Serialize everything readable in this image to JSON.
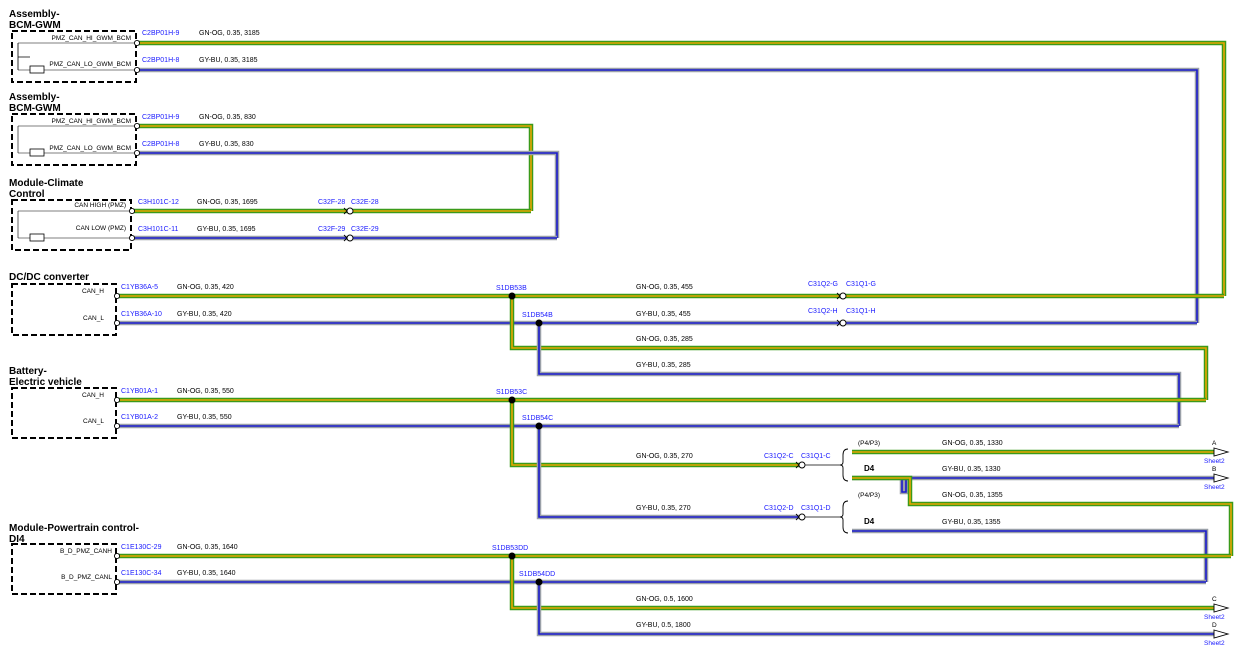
{
  "colors": {
    "can_hi_core": "#e8a600",
    "can_hi_outer": "#3a9a1a",
    "can_lo_core": "#1a1acc",
    "can_lo_outer": "#9aa0a8",
    "connector_label": "#1a1aff",
    "box_border": "#000000"
  },
  "components": [
    {
      "name_line1": "Assembly-",
      "name_line2": "BCM-GWM",
      "pin_hi": "PMZ_CAN_HI_GWM_BCM",
      "pin_lo": "PMZ_CAN_LO_GWM_BCM",
      "conn_hi": "C2BP01H-9",
      "conn_lo": "C2BP01H-8",
      "wire_hi": "GN-OG,  0.35,  3185",
      "wire_lo": "GY-BU,  0.35,  3185"
    },
    {
      "name_line1": "Assembly-",
      "name_line2": "BCM-GWM",
      "pin_hi": "PMZ_CAN_HI_GWM_BCM",
      "pin_lo": "PMZ_CAN_LO_GWM_BCM",
      "conn_hi": "C2BP01H-9",
      "conn_lo": "C2BP01H-8",
      "wire_hi": "GN-OG,  0.35,  830",
      "wire_lo": "GY-BU,  0.35,  830"
    },
    {
      "name_line1": "Module-Climate",
      "name_line2": "Control",
      "pin_hi": "CAN HIGH (PMZ)",
      "pin_lo": "CAN LOW (PMZ)",
      "conn_hi": "C3H101C-12",
      "conn_lo": "C3H101C-11",
      "wire_hi": "GN-OG,  0.35,  1695",
      "wire_lo": "GY-BU,  0.35,  1695"
    },
    {
      "name_line1": "DC/DC converter",
      "name_line2": "",
      "pin_hi": "CAN_H",
      "pin_lo": "CAN_L",
      "conn_hi": "C1YB36A-5",
      "conn_lo": "C1YB36A-10",
      "wire_hi": "GN-OG,  0.35,  420",
      "wire_lo": "GY-BU,  0.35,  420"
    },
    {
      "name_line1": "Battery-",
      "name_line2": "Electric vehicle",
      "pin_hi": "CAN_H",
      "pin_lo": "CAN_L",
      "conn_hi": "C1YB01A-1",
      "conn_lo": "C1YB01A-2",
      "wire_hi": "GN-OG,  0.35,  550",
      "wire_lo": "GY-BU,  0.35,  550"
    },
    {
      "name_line1": "Module-Powertrain control-",
      "name_line2": "DI4",
      "pin_hi": "B_D_PMZ_CANH",
      "pin_lo": "B_D_PMZ_CANL",
      "conn_hi": "C1E130C-29",
      "conn_lo": "C1E130C-34",
      "wire_hi": "GN-OG,  0.35,  1640",
      "wire_lo": "GY-BU,  0.35,  1640"
    }
  ],
  "climate_inline": {
    "hi_a": "C32F-28",
    "hi_b": "C32E-28",
    "lo_a": "C32F-29",
    "lo_b": "C32E-29"
  },
  "splices": {
    "s53b": "S1DB53B",
    "s54b": "S1DB54B",
    "s53c": "S1DB53C",
    "s54c": "S1DB54C",
    "s53dd": "S1DB53DD",
    "s54dd": "S1DB54DD"
  },
  "trunk_wires": {
    "hi_455": "GN-OG,  0.35,  455",
    "lo_455": "GY-BU,  0.35,  455",
    "hi_285": "GN-OG,  0.35,  285",
    "lo_285": "GY-BU,  0.35,  285",
    "hi_270": "GN-OG,  0.35,  270",
    "lo_270": "GY-BU,  0.35,  270",
    "hi_1330": "GN-OG,  0.35,  1330",
    "lo_1330": "GY-BU,  0.35,  1330",
    "hi_1355": "GN-OG,  0.35,  1355",
    "lo_1355": "GY-BU,  0.35,  1355",
    "hi_1600": "GN-OG,  0.5,  1600",
    "lo_1800": "GY-BU,  0.5,  1800"
  },
  "inline_connectors": {
    "g_a": "C31Q2-G",
    "g_b": "C31Q1-G",
    "h_a": "C31Q2-H",
    "h_b": "C31Q1-H",
    "c_a": "C31Q2-C",
    "c_b": "C31Q1-C",
    "d_a": "C31Q2-D",
    "d_b": "C31Q1-D"
  },
  "options": {
    "p4p3_a": "(P4/P3)",
    "d4_a": "D4",
    "p4p3_b": "(P4/P3)",
    "d4_b": "D4"
  },
  "offsheet": {
    "a_letter": "A",
    "b_letter": "B",
    "c_letter": "C",
    "d_letter": "D",
    "sheet": "Sheet2"
  }
}
